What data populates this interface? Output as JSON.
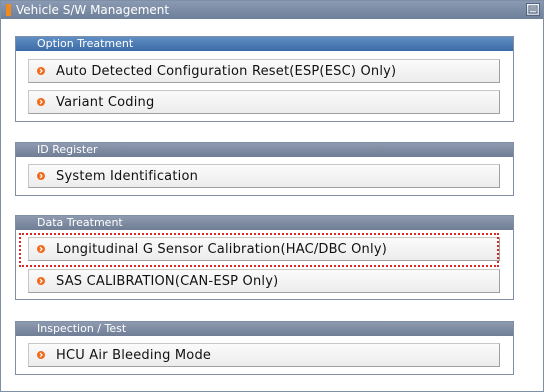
{
  "window": {
    "title": "Vehicle S/W Management"
  },
  "groups": [
    {
      "title": "Option Treatment",
      "items": [
        {
          "label": "Auto Detected Configuration Reset(ESP(ESC) Only)"
        },
        {
          "label": "Variant Coding"
        }
      ]
    },
    {
      "title": "ID Register",
      "items": [
        {
          "label": "System Identification"
        }
      ]
    },
    {
      "title": "Data Treatment",
      "items": [
        {
          "label": "Longitudinal  G  Sensor  Calibration(HAC/DBC  Only)"
        },
        {
          "label": "SAS CALIBRATION(CAN-ESP Only)"
        }
      ]
    },
    {
      "title": "Inspection / Test",
      "items": [
        {
          "label": "HCU Air Bleeding Mode"
        }
      ]
    }
  ],
  "colors": {
    "titlebar": "#7788a3",
    "group_header_active": "#4a78b3",
    "group_header": "#7d8aa2",
    "bullet": "#f26a1b",
    "highlight": "#d8281f"
  },
  "icons": [
    "window-icon",
    "close-icon",
    "bullet-arrow-icon"
  ]
}
